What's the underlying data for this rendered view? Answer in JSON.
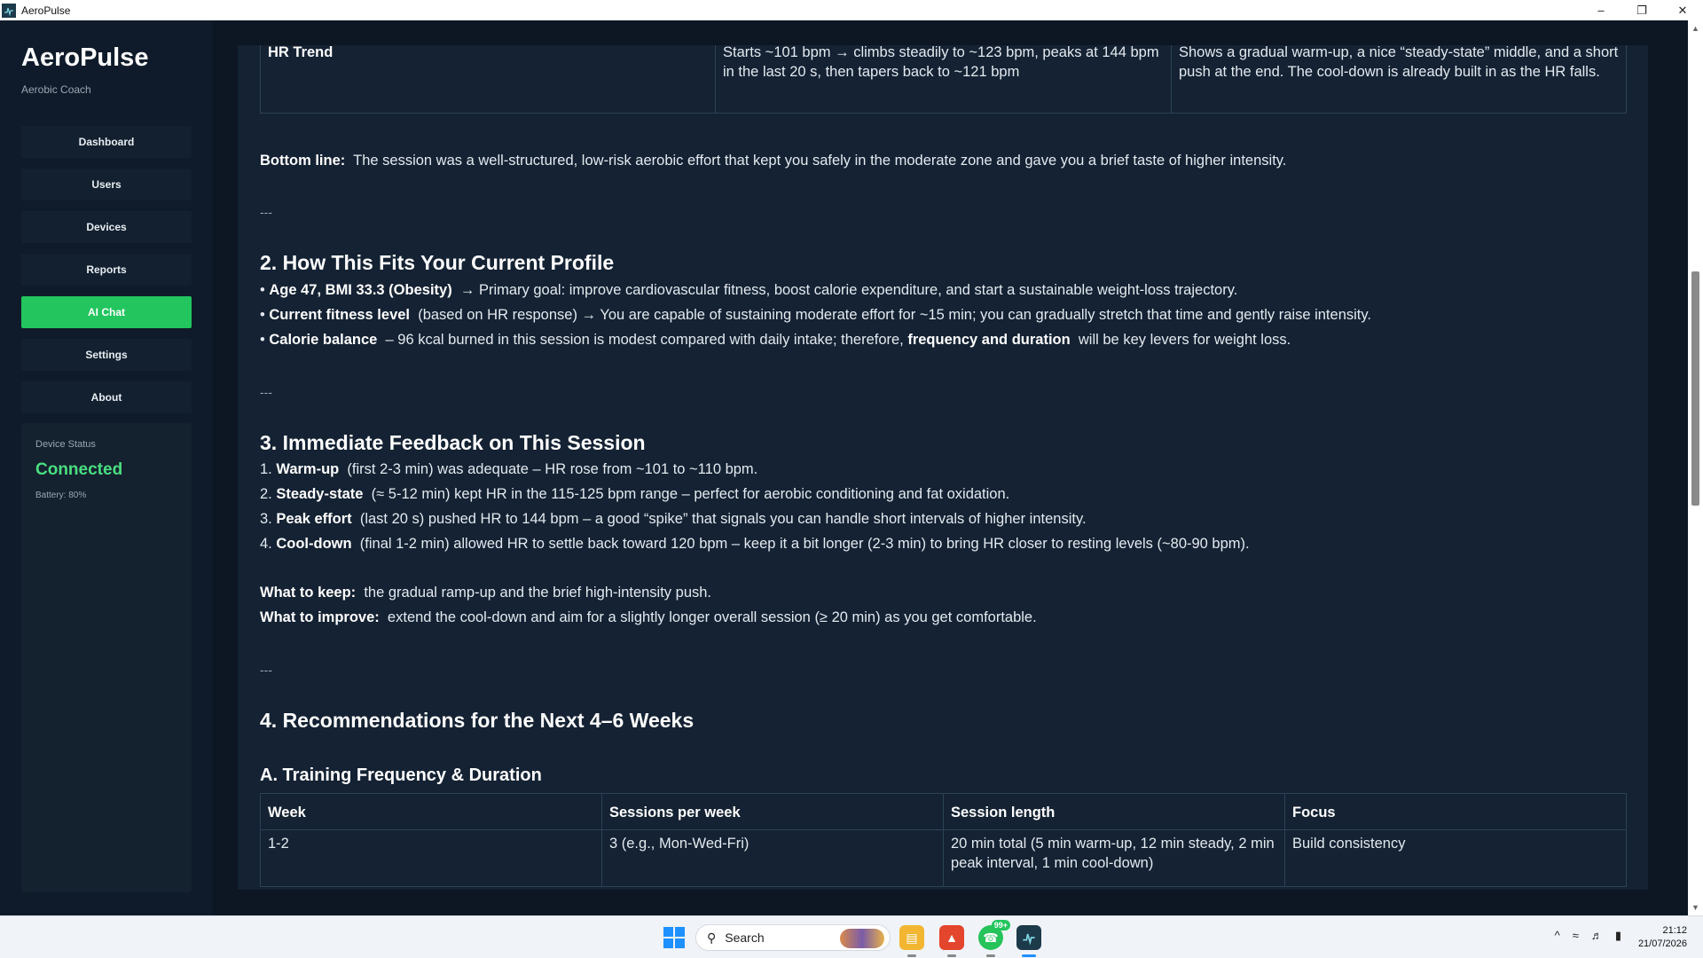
{
  "window": {
    "title": "AeroPulse",
    "controls": [
      "minimize",
      "maximize",
      "close"
    ]
  },
  "sidebar": {
    "brand": "AeroPulse",
    "subtitle": "Aerobic Coach",
    "items": [
      {
        "label": "Dashboard"
      },
      {
        "label": "Users"
      },
      {
        "label": "Devices"
      },
      {
        "label": "Reports"
      },
      {
        "label": "AI Chat",
        "active": true
      },
      {
        "label": "Settings"
      },
      {
        "label": "About"
      }
    ],
    "status": {
      "title": "Device Status",
      "value": "Connected",
      "battery": "Battery: 80%"
    },
    "active_color": "#22c55e"
  },
  "chat": {
    "hr_row": {
      "label": "HR Trend",
      "col2": "Starts ~101 bpm → climbs steadily to ~123 bpm, peaks at 144 bpm in the last 20 s, then tapers back to ~121 bpm",
      "col3": "Shows a gradual warm-up, a nice “steady-state” middle, and a short push at the end. The cool-down is already built in as the HR falls."
    },
    "bottom_line": {
      "label": "Bottom line:",
      "text": "The session was a well-structured, low-risk aerobic effort that kept you safely in the moderate zone and gave you a brief taste of higher intensity."
    },
    "separator": "---",
    "section2": {
      "title": "2. How This Fits Your Current Profile",
      "bullets": [
        {
          "prefix": "• ",
          "bold": "Age 47, BMI 33.3 (Obesity)",
          "text": " → Primary goal: improve cardiovascular fitness, boost calorie expenditure, and start a sustainable weight-loss trajectory."
        },
        {
          "prefix": "• ",
          "bold": "Current fitness level",
          "text": " (based on HR response) → You are capable of sustaining moderate effort for ~15 min; you can gradually stretch that time and gently raise intensity."
        },
        {
          "prefix": "• ",
          "bold": "Calorie balance",
          "text": " – 96 kcal burned in this session is modest compared with daily intake; therefore, ",
          "bold2": "frequency and duration",
          "text2": " will be key levers for weight loss."
        }
      ]
    },
    "section3": {
      "title": "3. Immediate Feedback on This Session",
      "items": [
        {
          "prefix": "1. ",
          "bold": "Warm-up",
          "text": " (first 2-3 min) was adequate – HR rose from ~101 to ~110 bpm."
        },
        {
          "prefix": "2. ",
          "bold": "Steady-state",
          "text": " (≈ 5-12 min) kept HR in the 115-125 bpm range – perfect for aerobic conditioning and fat oxidation."
        },
        {
          "prefix": "3. ",
          "bold": "Peak effort",
          "text": " (last 20 s) pushed HR to 144 bpm – a good “spike” that signals you can handle short intervals of higher intensity."
        },
        {
          "prefix": "4. ",
          "bold": "Cool-down",
          "text": " (final 1-2 min) allowed HR to settle back toward 120 bpm – keep it a bit longer (2-3 min) to bring HR closer to resting levels (~80-90 bpm)."
        }
      ],
      "keep": {
        "label": "What to keep:",
        "text": " the gradual ramp-up and the brief high-intensity push."
      },
      "improve": {
        "label": "What to improve:",
        "text": " extend the cool-down and aim for a slightly longer overall session (≥ 20 min) as you get comfortable."
      }
    },
    "section4": {
      "title": "4. Recommendations for the Next 4–6 Weeks",
      "subA": "A. Training Frequency & Duration",
      "table": {
        "headers": [
          "Week",
          "Sessions per week",
          "Session length",
          "Focus"
        ],
        "rows": [
          [
            "1-2",
            "3 (e.g., Mon-Wed-Fri)",
            "20 min total (5 min warm-up, 12 min steady, 2 min peak interval, 1 min cool-down)",
            "Build consistency"
          ]
        ]
      }
    }
  },
  "taskbar": {
    "search_label": "Search",
    "chat_badge": "99+",
    "time": "21:12",
    "date": "21/07/2026"
  }
}
